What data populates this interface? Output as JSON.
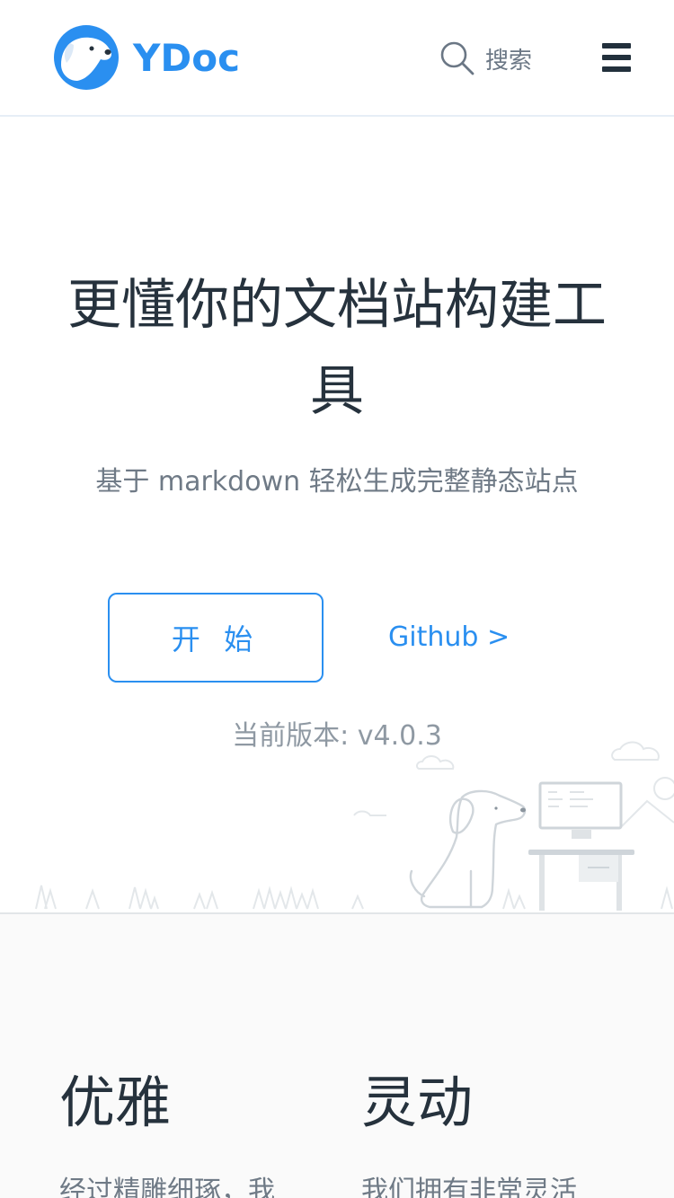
{
  "header": {
    "brand": "YDoc",
    "search_label": "搜索"
  },
  "hero": {
    "title": "更懂你的文档站构建工具",
    "subtitle": "基于 markdown 轻松生成完整静态站点",
    "start_label": "开 始",
    "github_label": "Github >",
    "version": "当前版本: v4.0.3"
  },
  "features": [
    {
      "title": "优雅",
      "desc": "经过精雕细琢，我"
    },
    {
      "title": "灵动",
      "desc": "我们拥有非常灵活"
    }
  ],
  "colors": {
    "accent": "#2a8ff0",
    "text": "#26323d",
    "muted": "#6f7a86"
  }
}
